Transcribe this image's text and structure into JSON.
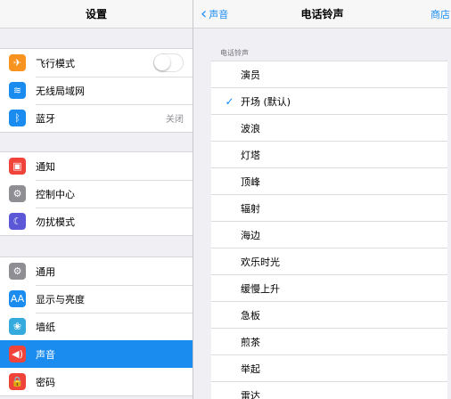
{
  "left": {
    "title": "设置",
    "groups": [
      [
        {
          "label": "飞行模式",
          "icon": "airplane-icon",
          "color": "#f7931e",
          "glyph": "✈",
          "accessory": "toggle",
          "toggle_on": false
        },
        {
          "label": "无线局域网",
          "icon": "wifi-icon",
          "color": "#1a8cf0",
          "glyph": "≋"
        },
        {
          "label": "蓝牙",
          "icon": "bluetooth-icon",
          "color": "#1a8cf0",
          "glyph": "ᛒ",
          "value": "关闭"
        }
      ],
      [
        {
          "label": "通知",
          "icon": "notifications-icon",
          "color": "#f0433a",
          "glyph": "▣"
        },
        {
          "label": "控制中心",
          "icon": "control-center-icon",
          "color": "#8e8e93",
          "glyph": "⚙"
        },
        {
          "label": "勿扰模式",
          "icon": "do-not-disturb-icon",
          "color": "#5b57d6",
          "glyph": "☾"
        }
      ],
      [
        {
          "label": "通用",
          "icon": "general-icon",
          "color": "#8e8e93",
          "glyph": "⚙"
        },
        {
          "label": "显示与亮度",
          "icon": "display-brightness-icon",
          "color": "#1a8cf0",
          "glyph": "AA"
        },
        {
          "label": "墙纸",
          "icon": "wallpaper-icon",
          "color": "#35aadc",
          "glyph": "❀"
        },
        {
          "label": "声音",
          "icon": "sounds-icon",
          "color": "#f0433a",
          "glyph": "◀)",
          "selected": true
        },
        {
          "label": "密码",
          "icon": "passcode-icon",
          "color": "#f0433a",
          "glyph": "🔒"
        }
      ]
    ]
  },
  "right": {
    "back_label": "声音",
    "title": "电话铃声",
    "store_label": "商店",
    "section_label": "电话铃声",
    "tones": [
      {
        "name": "演员",
        "checked": false
      },
      {
        "name": "开场 (默认)",
        "checked": true
      },
      {
        "name": "波浪",
        "checked": false
      },
      {
        "name": "灯塔",
        "checked": false
      },
      {
        "name": "顶峰",
        "checked": false
      },
      {
        "name": "辐射",
        "checked": false
      },
      {
        "name": "海边",
        "checked": false
      },
      {
        "name": "欢乐时光",
        "checked": false
      },
      {
        "name": "缓慢上升",
        "checked": false
      },
      {
        "name": "急板",
        "checked": false
      },
      {
        "name": "煎茶",
        "checked": false
      },
      {
        "name": "举起",
        "checked": false
      },
      {
        "name": "雷达",
        "checked": false
      }
    ],
    "check_glyph": "✓"
  },
  "colors": {
    "accent": "#1a8cf0",
    "background": "#efeff4"
  }
}
